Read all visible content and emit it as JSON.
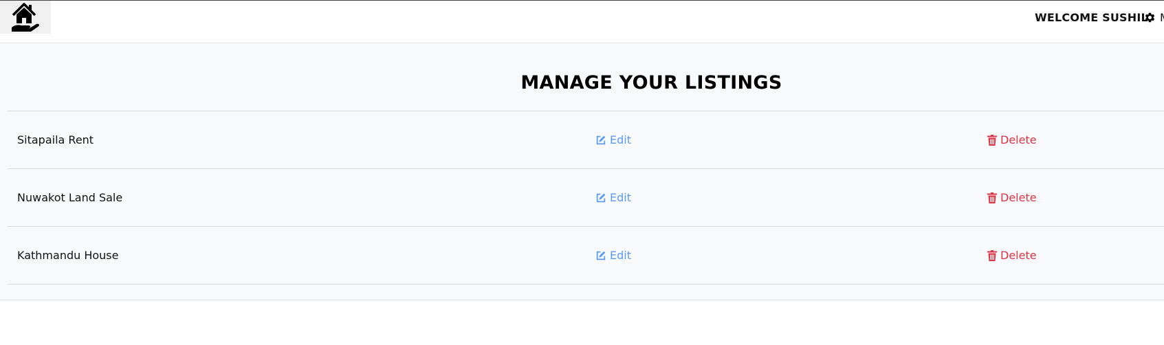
{
  "header": {
    "welcome_text": "WELCOME SUSHIL",
    "settings_label": "M"
  },
  "icons": {
    "logo": "house-in-hand-icon",
    "settings": "gear-icon",
    "edit": "edit-icon",
    "delete": "trash-icon"
  },
  "colors": {
    "edit": "#5b9bf0",
    "delete": "#dc3545",
    "main_bg": "#f8f9fa"
  },
  "page": {
    "title": "MANAGE YOUR LISTINGS"
  },
  "listings": [
    {
      "name": "Sitapaila Rent",
      "edit_label": "Edit",
      "delete_label": "Delete"
    },
    {
      "name": "Nuwakot Land Sale",
      "edit_label": "Edit",
      "delete_label": "Delete"
    },
    {
      "name": "Kathmandu House",
      "edit_label": "Edit",
      "delete_label": "Delete"
    }
  ]
}
